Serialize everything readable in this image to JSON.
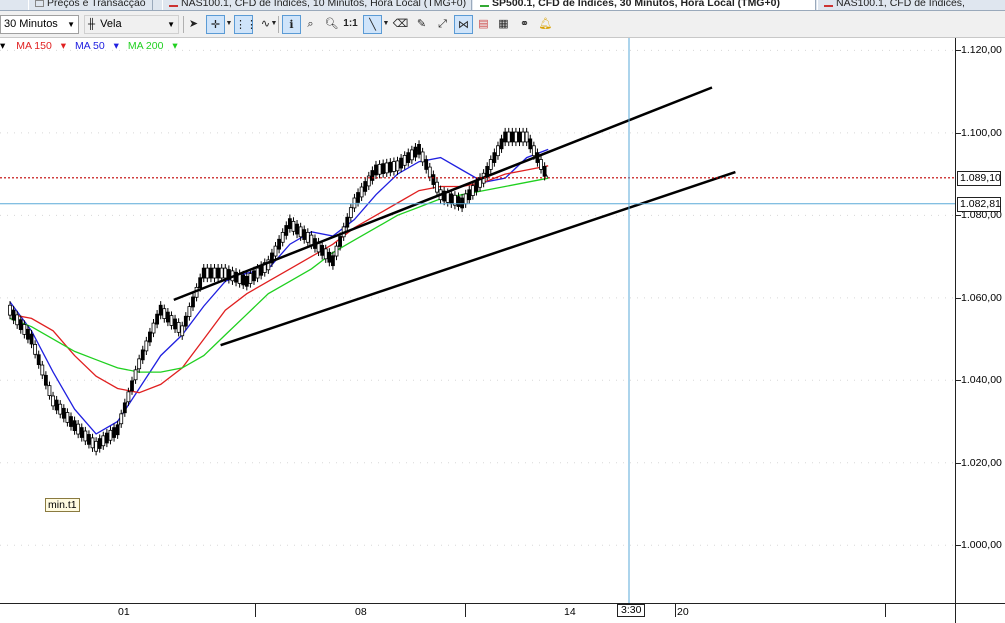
{
  "tabs": [
    {
      "label": "Preços e Transacção",
      "active": false
    },
    {
      "label": "NAS100.1, CFD de Índices, 10 Minutos, Hora Local (TMG+0)",
      "active": false
    },
    {
      "label": "SP500.1, CFD de Índices, 30 Minutos, Hora Local (TMG+0)",
      "active": true
    },
    {
      "label": "NAS100.1, CFD de Índices,",
      "active": false
    }
  ],
  "toolbar": {
    "timeframe": "30 Minutos",
    "chart_type": "Vela",
    "zoom_reset_label": "1:1"
  },
  "legend": {
    "ma150": "MA 150",
    "ma50": "MA 50",
    "ma200": "MA 200"
  },
  "colors": {
    "ma150": "#e02020",
    "ma50": "#2020e0",
    "ma200": "#20d020",
    "last_price_line": "#c00000",
    "cursor_line": "#5aaad8",
    "trendline": "#000000"
  },
  "yaxis": {
    "ticks": [
      "1.120,00",
      "1.100,00",
      "1.080,00",
      "1.060,00",
      "1.040,00",
      "1.020,00",
      "1.000,00"
    ],
    "last_price": "1.089,10",
    "cursor_price": "1.082,81"
  },
  "xaxis": {
    "labels": [
      "01",
      "08",
      "14",
      "20"
    ],
    "cursor_time": "3:30"
  },
  "annotation": {
    "min_label": "min.t1"
  },
  "chart_data": {
    "type": "line",
    "title": "",
    "ylim": [
      986,
      1123
    ],
    "grid": true,
    "series": [
      {
        "name": "MA 50",
        "values": [
          1059.0,
          1052.0,
          1042.0,
          1033.0,
          1027.0,
          1030.0,
          1038.0,
          1046.0,
          1051.0,
          1058.0,
          1064.0,
          1066.0,
          1067.0,
          1073.0,
          1076.0,
          1075.0,
          1079.0,
          1085.0,
          1090.0,
          1093.0,
          1094.0,
          1091.0,
          1088.0,
          1089.0,
          1094.0,
          1096.0
        ]
      },
      {
        "name": "MA 150",
        "values": [
          1056.0,
          1055.0,
          1052.0,
          1046.0,
          1041.0,
          1038.0,
          1037.0,
          1039.0,
          1043.0,
          1050.0,
          1057.0,
          1061.0,
          1064.0,
          1067.0,
          1070.0,
          1073.0,
          1077.0,
          1080.0,
          1083.0,
          1086.0,
          1087.0,
          1087.0,
          1088.0,
          1090.0,
          1091.0,
          1092.0
        ]
      },
      {
        "name": "MA 200",
        "values": [
          1055.0,
          1053.0,
          1050.0,
          1047.0,
          1045.0,
          1043.0,
          1042.0,
          1042.0,
          1043.0,
          1046.0,
          1051.0,
          1056.0,
          1061.0,
          1064.0,
          1067.0,
          1071.0,
          1074.0,
          1077.0,
          1080.0,
          1082.0,
          1084.0,
          1085.0,
          1086.0,
          1087.0,
          1088.0,
          1089.0
        ]
      },
      {
        "name": "",
        "values": [
          1057.0,
          1050.0,
          1035.0,
          1029.0,
          1024.0,
          1028.0,
          1044.0,
          1057.0,
          1052.0,
          1066.0,
          1066.0,
          1064.0,
          1068.0,
          1078.0,
          1074.0,
          1069.0,
          1083.0,
          1091.0,
          1092.0,
          1096.0,
          1085.0,
          1083.0,
          1089.0,
          1099.0,
          1099.0,
          1089.0
        ]
      }
    ],
    "trendlines": [
      {
        "from": [
          7,
          1059.5
        ],
        "to": [
          30,
          1111.0
        ]
      },
      {
        "from": [
          9,
          1048.5
        ],
        "to": [
          31,
          1090.5
        ]
      }
    ],
    "hlines": [
      1089.1,
      1082.81
    ],
    "x_count": 32
  }
}
